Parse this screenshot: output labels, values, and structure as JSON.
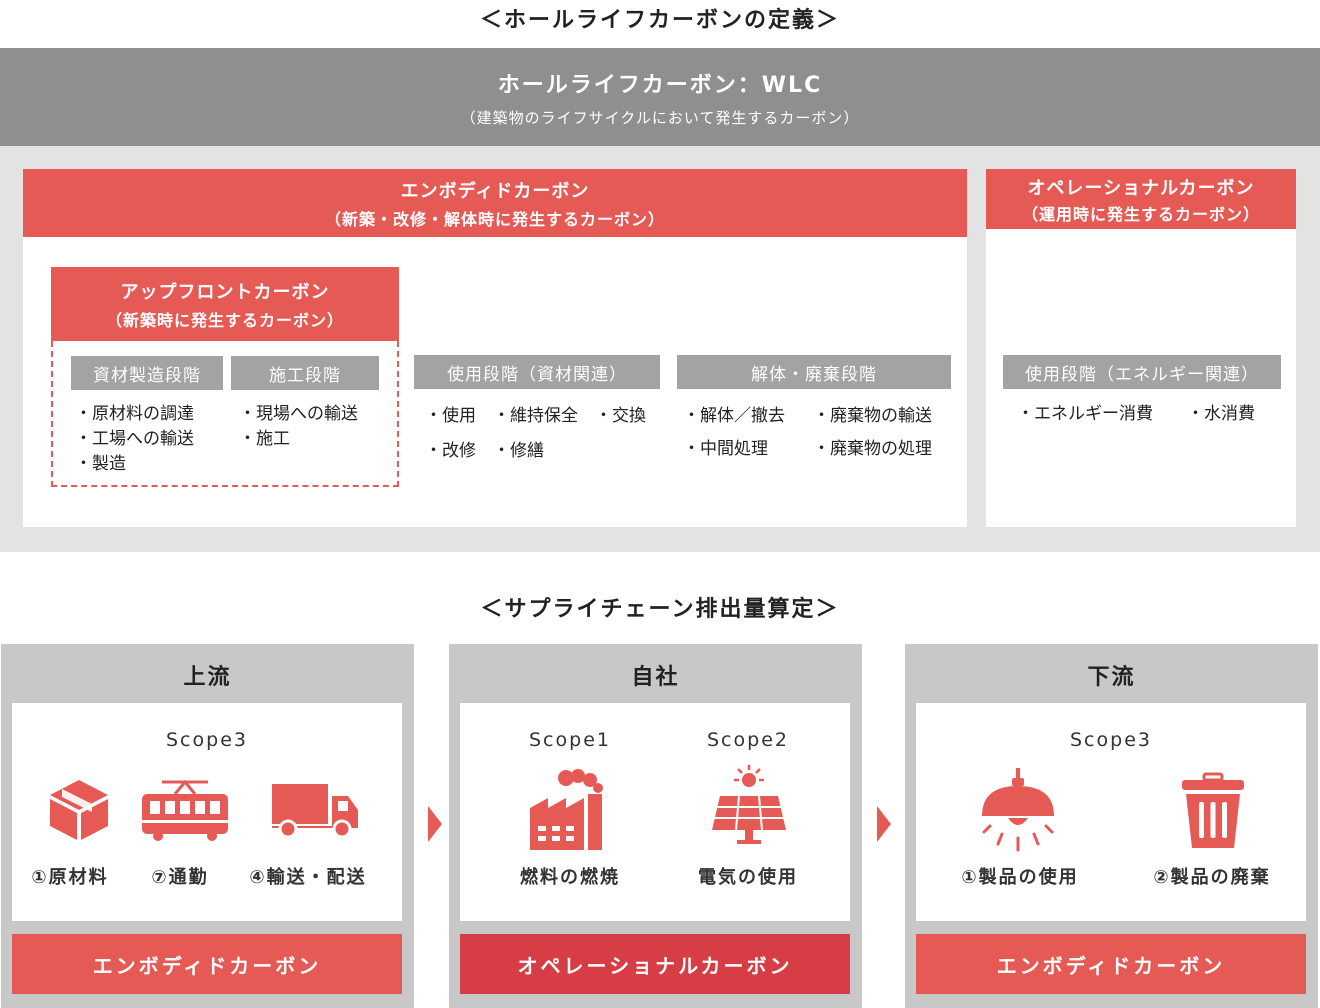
{
  "colors": {
    "accent_red": "#e55a55",
    "operational_red": "#d73d44",
    "dark_gray": "#8f8f8f",
    "label_gray": "#a3a3a3",
    "bg_gray": "#e3e3e3"
  },
  "top": {
    "section_title": "＜ホールライフカーボンの定義＞",
    "wlc": {
      "title": "ホールライフカーボン：WLC",
      "subtitle": "（建築物のライフサイクルにおいて発生するカーボン）"
    },
    "embodied": {
      "title": "エンボディドカーボン",
      "subtitle": "（新築・改修・解体時に発生するカーボン）"
    },
    "operational": {
      "title": "オペレーショナルカーボン",
      "subtitle": "（運用時に発生するカーボン）"
    },
    "upfront": {
      "title": "アップフロントカーボン",
      "subtitle": "（新築時に発生するカーボン）"
    },
    "stages": {
      "materials": {
        "label": "資材製造段階",
        "items": [
          "・原材料の調達",
          "・工場への輸送",
          "・製造"
        ]
      },
      "construction": {
        "label": "施工段階",
        "items": [
          "・現場への輸送",
          "・施工"
        ]
      },
      "use_material": {
        "label": "使用段階（資材関連）",
        "items": [
          "・使用　・維持保全　・交換",
          "・改修　・修繕"
        ]
      },
      "demolition": {
        "label": "解体・廃棄段階",
        "items": [
          "・解体／撤去",
          "・廃棄物の輸送",
          "・中間処理",
          "・廃棄物の処理"
        ]
      },
      "use_energy": {
        "label": "使用段階（エネルギー関連）",
        "items": [
          "・エネルギー消費",
          "・水消費"
        ]
      }
    }
  },
  "bottom": {
    "section_title": "＜サプライチェーン排出量算定＞",
    "upstream": {
      "title": "上流",
      "scope": "Scope3",
      "items": [
        {
          "icon": "box-icon",
          "label": "①原材料"
        },
        {
          "icon": "train-icon",
          "label": "⑦通勤"
        },
        {
          "icon": "truck-icon",
          "label": "④輸送・配送"
        }
      ],
      "footer": "エンボディドカーボン"
    },
    "company": {
      "title": "自社",
      "scope1": "Scope1",
      "scope2": "Scope2",
      "items": [
        {
          "icon": "factory-icon",
          "label": "燃料の燃焼"
        },
        {
          "icon": "solar-panel-icon",
          "label": "電気の使用"
        }
      ],
      "footer": "オペレーショナルカーボン"
    },
    "downstream": {
      "title": "下流",
      "scope": "Scope3",
      "items": [
        {
          "icon": "lamp-icon",
          "label": "①製品の使用"
        },
        {
          "icon": "trash-can-icon",
          "label": "②製品の廃棄"
        }
      ],
      "footer": "エンボディドカーボン"
    }
  }
}
